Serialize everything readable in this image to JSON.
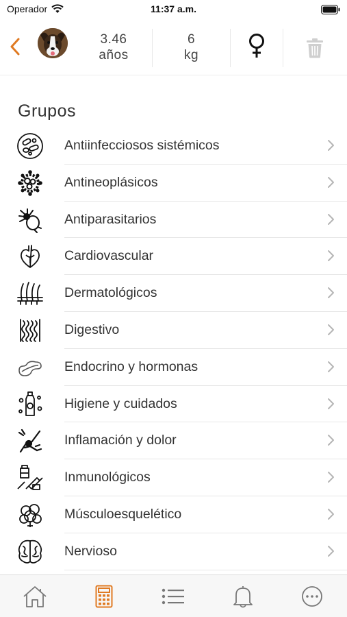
{
  "status": {
    "carrier": "Operador",
    "time": "11:37 a.m."
  },
  "header": {
    "age_value": "3.46",
    "age_unit": "años",
    "weight_value": "6",
    "weight_unit": "kg",
    "gender": "female",
    "accent_color": "#e07a22"
  },
  "section_title": "Grupos",
  "groups": [
    {
      "label": "Antiinfecciosos sistémicos",
      "icon": "bacteria-icon"
    },
    {
      "label": "Antineoplásicos",
      "icon": "cancer-cell-icon"
    },
    {
      "label": "Antiparasitarios",
      "icon": "tick-parasite-icon"
    },
    {
      "label": "Cardiovascular",
      "icon": "heart-icon"
    },
    {
      "label": "Dermatológicos",
      "icon": "skin-hair-icon"
    },
    {
      "label": "Digestivo",
      "icon": "intestine-icon"
    },
    {
      "label": "Endocrino y hormonas",
      "icon": "pancreas-icon"
    },
    {
      "label": "Higiene y cuidados",
      "icon": "shampoo-bottle-icon"
    },
    {
      "label": "Inflamación y dolor",
      "icon": "joint-pain-icon"
    },
    {
      "label": "Inmunológicos",
      "icon": "vaccine-icon"
    },
    {
      "label": "Músculoesquelético",
      "icon": "muscle-bone-icon"
    },
    {
      "label": "Nervioso",
      "icon": "brain-icon"
    }
  ],
  "tabbar": {
    "active_tab": "calculator",
    "tabs": [
      "home",
      "calculator",
      "list",
      "notifications",
      "more"
    ]
  }
}
